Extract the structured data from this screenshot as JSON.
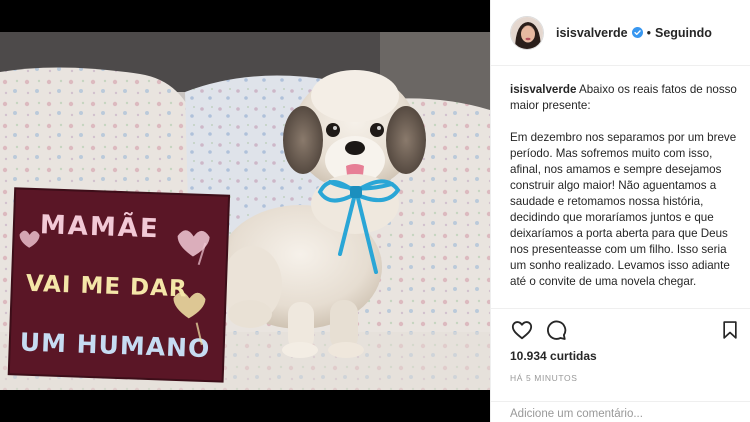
{
  "post": {
    "username": "isisvalverde",
    "follow_status": "Seguindo",
    "separator": "•",
    "verified_color": "#3897f0"
  },
  "photo": {
    "sign_lines": [
      "MAMÃE",
      "VAI ME DAR",
      "UM HUMANO"
    ],
    "sign_color": "#5a1626",
    "ribbon_color": "#2aa6d6"
  },
  "caption": {
    "username": "isisvalverde",
    "line1_rest": " Abaixo os reais fatos de nosso",
    "lines_intro": [
      "maior presente:"
    ],
    "lines_body": [
      "Em dezembro nos separamos por um breve",
      "período. Mas sofremos muito com isso,",
      "afinal, nos amamos e sempre desejamos",
      "construir algo maior! Não aguentamos a",
      "saudade e retomamos nossa história,",
      "decidindo que moraríamos juntos e que",
      "deixaríamos a porta aberta para que Deus",
      "nos presenteasse com um filho. Isso seria",
      "um sonho realizado. Levamos isso adiante",
      "até o convite de uma novela chegar."
    ]
  },
  "actions": {
    "like_icon": "heart-icon",
    "comment_icon": "speech-bubble-icon",
    "save_icon": "bookmark-icon"
  },
  "likes_text": "10.934 curtidas",
  "timestamp": "HÁ 5 MINUTOS",
  "comment_placeholder": "Adicione um comentário..."
}
